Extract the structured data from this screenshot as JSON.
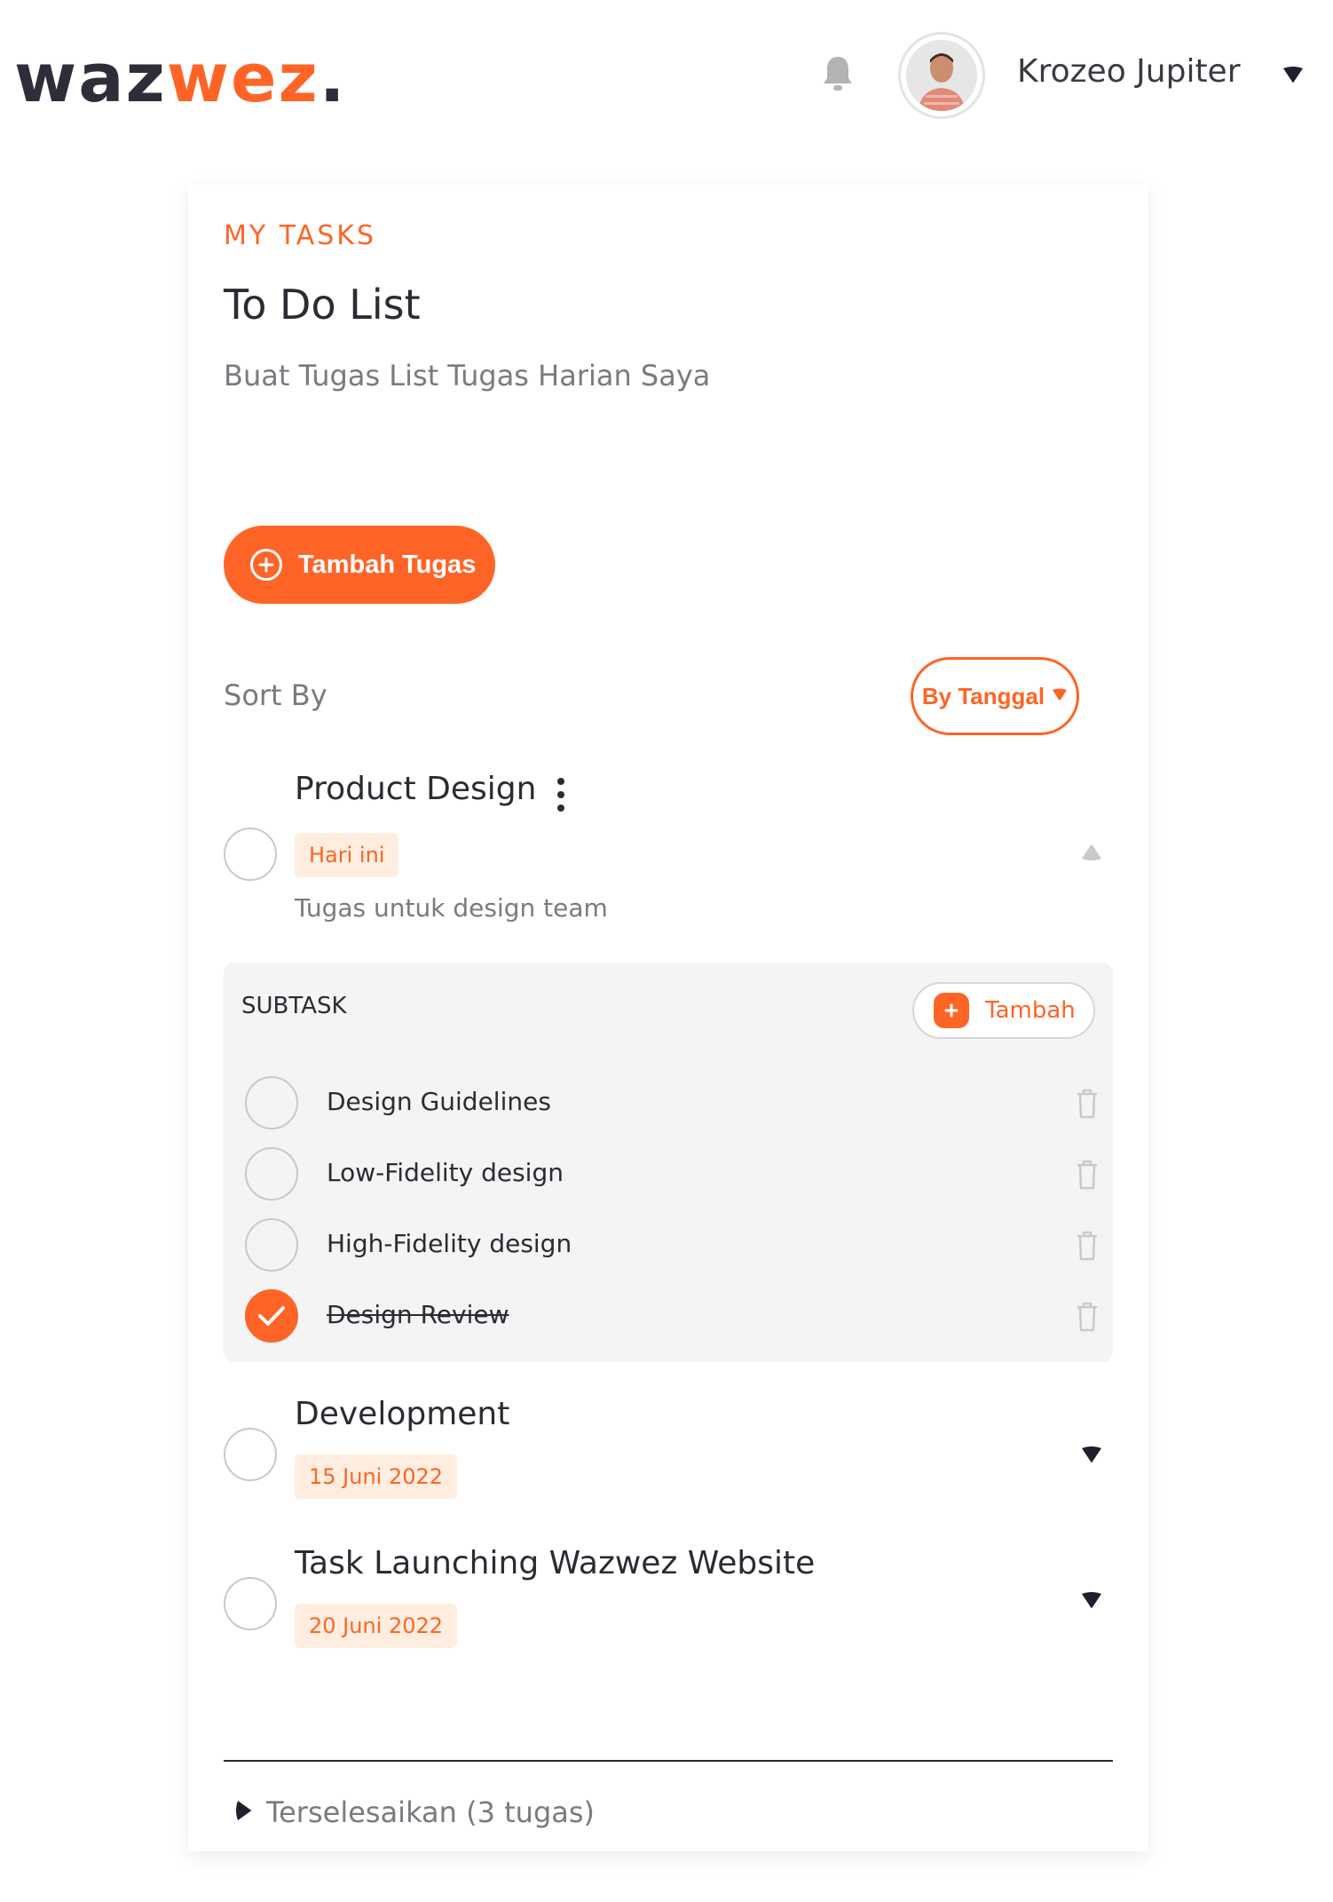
{
  "header": {
    "logo_part1": "waz",
    "logo_part2": "wez",
    "logo_dot": ".",
    "user_name": "Krozeo Jupiter",
    "icons": {
      "notification": "bell-icon",
      "user_menu": "caret-down-icon"
    }
  },
  "page": {
    "eyebrow": "MY TASKS",
    "title": "To Do List",
    "subtitle": "Buat Tugas List Tugas Harian Saya",
    "add_task_label": "Tambah Tugas",
    "sort_label": "Sort By",
    "sort_value": "By Tanggal"
  },
  "tasks": [
    {
      "title": "Product Design",
      "badge": "Hari ini",
      "description": "Tugas untuk design team",
      "expanded": true,
      "done": false
    },
    {
      "title": "Development",
      "badge": "15 Juni 2022",
      "expanded": false,
      "done": false
    },
    {
      "title": "Task Launching Wazwez Website",
      "badge": "20 Juni 2022",
      "expanded": false,
      "done": false
    }
  ],
  "subtasks": {
    "heading": "SUBTASK",
    "add_label": "Tambah",
    "items": [
      {
        "label": "Design Guidelines",
        "done": false
      },
      {
        "label": "Low-Fidelity design",
        "done": false
      },
      {
        "label": "High-Fidelity design",
        "done": false
      },
      {
        "label": "Design Review",
        "done": true
      }
    ]
  },
  "completed": {
    "label": "Terselesaikan (3 tugas)"
  },
  "colors": {
    "accent": "#ff6427",
    "dark": "#2d2e3a",
    "muted": "#7a7a80",
    "badge_bg": "#ffeedf",
    "panel_bg": "#f4f4f4"
  }
}
